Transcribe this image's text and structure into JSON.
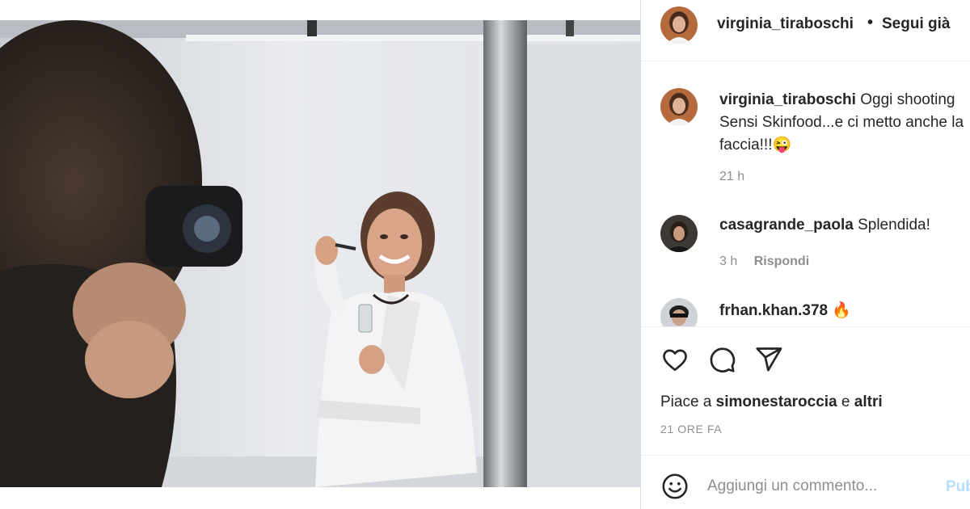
{
  "post": {
    "author": "virginia_tiraboschi",
    "separator": "•",
    "follow_status": "Segui già"
  },
  "caption": {
    "username": "virginia_tiraboschi",
    "text": "Oggi shooting Sensi Skinfood...e ci metto anche la faccia!!!😜",
    "time": "21 h"
  },
  "comments": [
    {
      "username": "casagrande_paola",
      "text": "Splendida!",
      "time": "3 h",
      "reply_label": "Rispondi"
    },
    {
      "username": "frhan.khan.378",
      "text": "🔥"
    }
  ],
  "likes": {
    "prefix": "Piace a",
    "user": "simonestaroccia",
    "conjunction": "e",
    "others": "altri"
  },
  "post_age": "21 ORE FA",
  "add_comment": {
    "placeholder": "Aggiungi un commento...",
    "publish_label": "Pubblica"
  },
  "icons": {
    "like": "heart-icon",
    "comment": "speech-bubble-icon",
    "share": "paper-plane-icon",
    "emoji": "smiley-icon"
  },
  "colors": {
    "text": "#262626",
    "secondary_text": "#8e8e8e",
    "publish_disabled": "#b2dffc",
    "divider": "#dbdbdb"
  }
}
